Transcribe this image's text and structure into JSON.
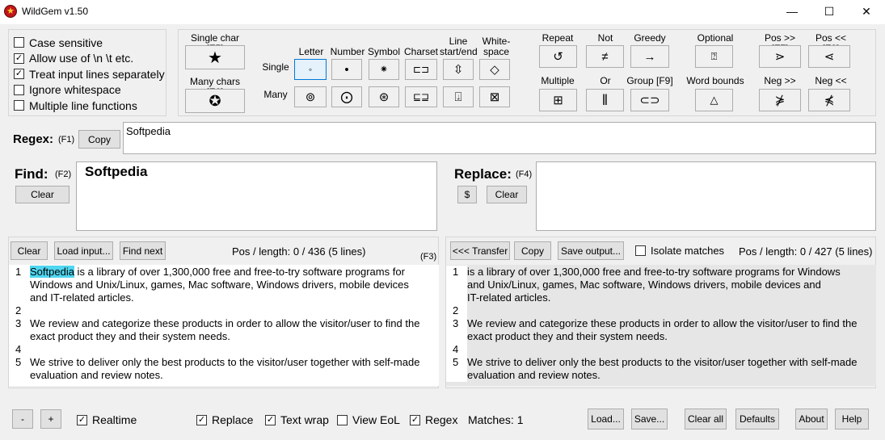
{
  "window": {
    "title": "WildGem v1.50",
    "minimize": "—",
    "maximize": "☐",
    "close": "✕"
  },
  "options": [
    {
      "label": "Case sensitive",
      "checked": false
    },
    {
      "label": "Allow use of \\n \\t etc.",
      "checked": true
    },
    {
      "label": "Treat input lines separately",
      "checked": true
    },
    {
      "label": "Ignore whitespace",
      "checked": false
    },
    {
      "label": "Multiple line functions",
      "checked": false
    }
  ],
  "toolbar": {
    "single_char": "Single char [F5]",
    "many_chars": "Many chars [F6]",
    "row_single": "Single",
    "row_many": "Many",
    "col_letter": "Letter",
    "col_number": "Number",
    "col_symbol": "Symbol",
    "col_charset": "Charset",
    "col_line": "Line start/end",
    "col_white": "White-space",
    "repeat": "Repeat",
    "not": "Not",
    "greedy": "Greedy",
    "optional": "Optional",
    "pos_fwd": "Pos >> [F7]",
    "pos_back": "Pos << [F8]",
    "multiple": "Multiple",
    "or": "Or",
    "group": "Group [F9]",
    "word_bounds": "Word bounds",
    "neg_fwd": "Neg >>",
    "neg_back": "Neg <<"
  },
  "regex": {
    "label": "Regex:",
    "key": "(F1)",
    "copy": "Copy",
    "value": "Softpedia"
  },
  "find": {
    "label": "Find:",
    "key": "(F2)",
    "clear": "Clear",
    "value": "Softpedia"
  },
  "replace": {
    "label": "Replace:",
    "key": "(F4)",
    "dollar": "$",
    "clear": "Clear",
    "value": ""
  },
  "input_bar": {
    "clear": "Clear",
    "load": "Load input...",
    "find_next": "Find next",
    "pos": "Pos / length: 0 / 436 (5 lines)",
    "key": "(F3)"
  },
  "output_bar": {
    "transfer": "<<< Transfer",
    "copy": "Copy",
    "save": "Save output...",
    "isolate": "Isolate matches",
    "pos": "Pos / length: 0 / 427 (5 lines)"
  },
  "input_lines": [
    {
      "n": "1",
      "hl": "Softpedia",
      "t": " is a library of over 1,300,000 free and free-to-try software programs for"
    },
    {
      "n": "",
      "hl": "",
      "t": "Windows and Unix/Linux, games, Mac software, Windows drivers, mobile devices"
    },
    {
      "n": "",
      "hl": "",
      "t": "and IT-related articles."
    },
    {
      "n": "2",
      "hl": "",
      "t": ""
    },
    {
      "n": "3",
      "hl": "",
      "t": "We review and categorize these products in order to allow the visitor/user to find the"
    },
    {
      "n": "",
      "hl": "",
      "t": "exact product they and their system needs."
    },
    {
      "n": "4",
      "hl": "",
      "t": ""
    },
    {
      "n": "5",
      "hl": "",
      "t": "We strive to deliver only the best products to the visitor/user together with self-made"
    },
    {
      "n": "",
      "hl": "",
      "t": "evaluation and review notes."
    }
  ],
  "output_lines": [
    {
      "n": "1",
      "t": " is a library of over 1,300,000 free and free-to-try software programs for Windows"
    },
    {
      "n": "",
      "t": "and Unix/Linux, games, Mac software, Windows drivers, mobile devices and"
    },
    {
      "n": "",
      "t": "IT-related articles."
    },
    {
      "n": "2",
      "t": ""
    },
    {
      "n": "3",
      "t": "We review and categorize these products in order to allow the visitor/user to find the"
    },
    {
      "n": "",
      "t": "exact product they and their system needs."
    },
    {
      "n": "4",
      "t": ""
    },
    {
      "n": "5",
      "t": "We strive to deliver only the best products to the visitor/user together with self-made"
    },
    {
      "n": "",
      "t": "evaluation and review notes."
    }
  ],
  "bottom": {
    "minus": "-",
    "plus": "+",
    "realtime": "Realtime",
    "replace": "Replace",
    "textwrap": "Text wrap",
    "vieweol": "View EoL",
    "regex": "Regex",
    "matches": "Matches: 1",
    "load": "Load...",
    "save": "Save...",
    "clear_all": "Clear all",
    "defaults": "Defaults",
    "about": "About",
    "help": "Help"
  },
  "colors": {
    "highlight": "#4fd6f0",
    "output_bg": "#e6e6e6"
  }
}
